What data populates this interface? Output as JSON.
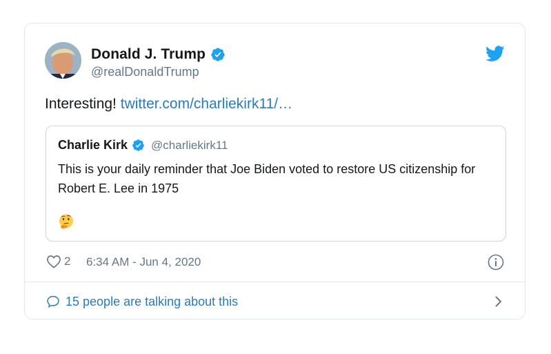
{
  "tweet": {
    "author": {
      "name": "Donald J. Trump",
      "handle": "@realDonaldTrump",
      "verified": true,
      "avatar_icon": "user-portrait"
    },
    "text": "Interesting! ",
    "link_text": "twitter.com/charliekirk11/…",
    "quoted": {
      "name": "Charlie Kirk",
      "handle": "@charliekirk11",
      "verified": true,
      "text": "This is your daily reminder that Joe Biden voted to restore US citizenship for Robert E. Lee in 1975",
      "emoji_icon": "thinking-face"
    },
    "likes": "2",
    "timestamp": "6:34 AM - Jun 4, 2020",
    "talking": "15 people are talking about this"
  },
  "colors": {
    "brand_blue": "#1da1f2",
    "link_blue": "#2b7bb9",
    "secondary_text": "#657786",
    "border": "#e1e8ed"
  }
}
